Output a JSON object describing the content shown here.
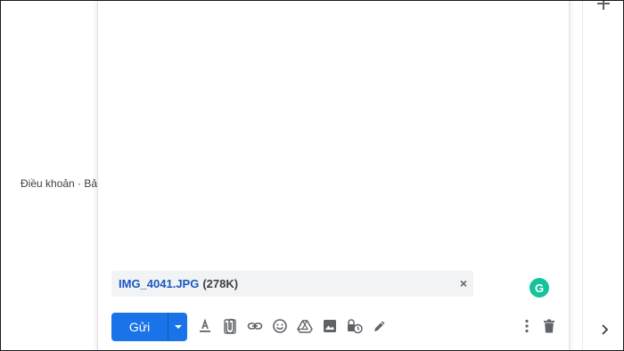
{
  "background": {
    "footer_text": "Điều khoản · Bảo"
  },
  "attachment": {
    "file_name": "IMG_4041.JPG",
    "file_size": "(278K)",
    "close_glyph": "×"
  },
  "grammarly": {
    "label": "G",
    "color": "#15c39a"
  },
  "send": {
    "label": "Gửi",
    "color": "#1a73e8"
  },
  "toolbar": {
    "icons": [
      "format-text-icon",
      "attach-file-icon",
      "insert-link-icon",
      "emoji-icon",
      "google-drive-icon",
      "insert-photo-icon",
      "confidential-mode-icon",
      "signature-icon",
      "more-options-icon",
      "discard-draft-icon"
    ]
  },
  "side_panel": {
    "icons": [
      "add-icon",
      "chevron-right-icon"
    ]
  }
}
